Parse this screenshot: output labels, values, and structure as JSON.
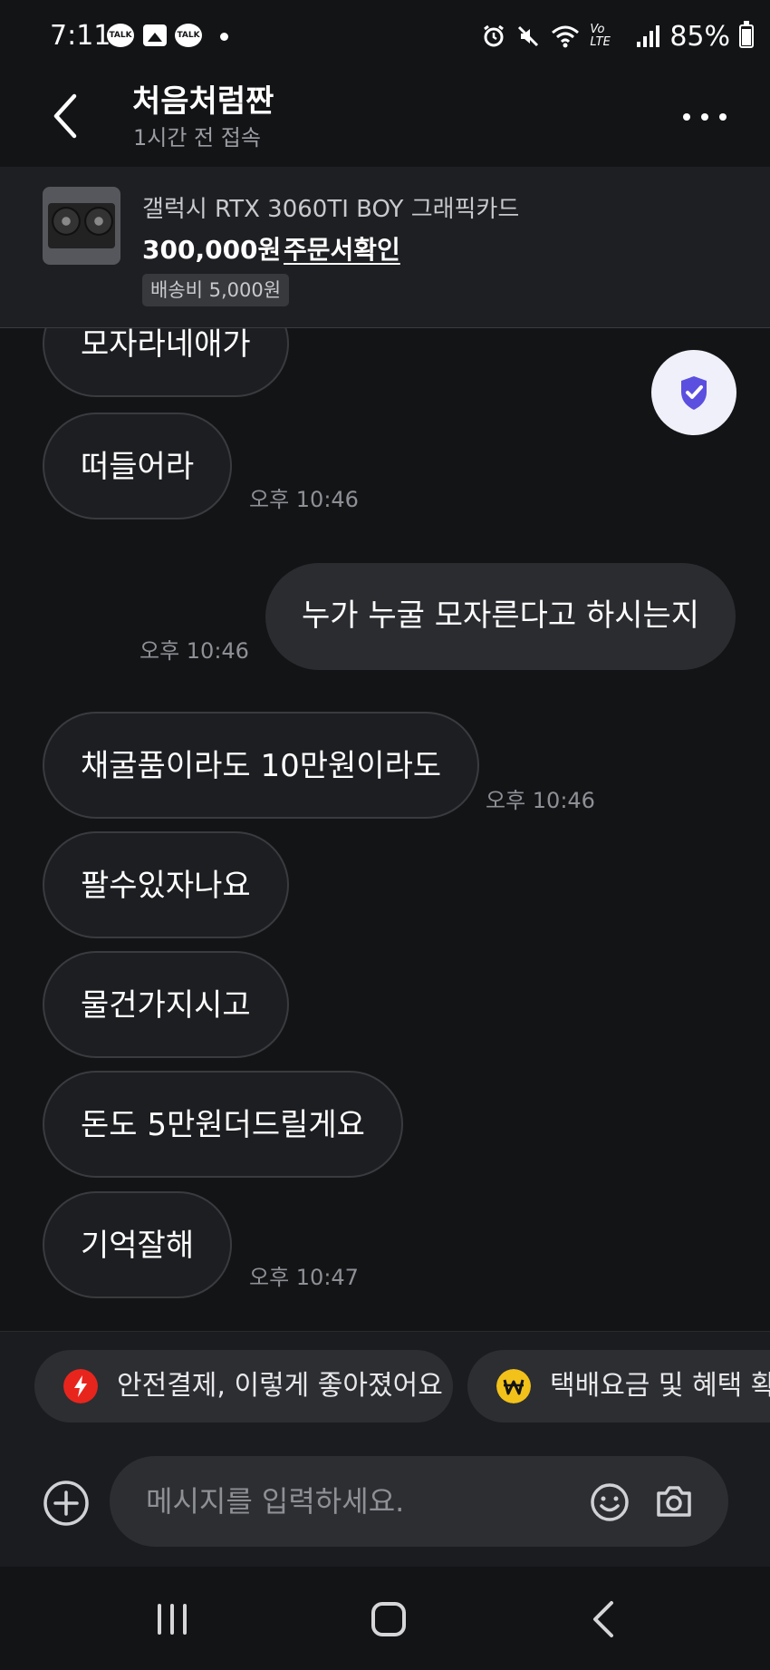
{
  "status_bar": {
    "time": "7:11",
    "notification_icons": [
      "talk-icon",
      "gallery-icon",
      "talk-icon"
    ],
    "talk_label": "TALK",
    "network_label": "Vo LTE",
    "battery": "85%"
  },
  "header": {
    "title": "처음처럼짠",
    "subtitle": "1시간 전 접속"
  },
  "product": {
    "name": "갤럭시 RTX 3060TI BOY 그래픽카드",
    "price": "300,000원",
    "order_link": "주문서확인",
    "shipping": "배송비 5,000원"
  },
  "messages": [
    {
      "side": "in",
      "text": "모자라네애가",
      "time": ""
    },
    {
      "side": "in",
      "text": "떠들어라",
      "time": "오후 10:46"
    },
    {
      "side": "out",
      "text": "누가 누굴 모자른다고 하시는지",
      "time": "오후 10:46"
    },
    {
      "side": "in",
      "text": "채굴품이라도 10만원이라도",
      "time": "오후 10:46"
    },
    {
      "side": "in",
      "text": "팔수있자나요",
      "time": ""
    },
    {
      "side": "in",
      "text": "물건가지시고",
      "time": ""
    },
    {
      "side": "in",
      "text": "돈도 5만원더드릴게요",
      "time": ""
    },
    {
      "side": "in",
      "text": "기억잘해",
      "time": "오후 10:47"
    }
  ],
  "suggestions": [
    {
      "label": "안전결제, 이렇게 좋아졌어요",
      "icon": "lightning-icon",
      "color": "#e8251d"
    },
    {
      "label": "택배요금 및 혜택 확인",
      "icon": "won-icon",
      "color": "#f2c21b"
    }
  ],
  "composer": {
    "placeholder": "메시지를 입력하세요."
  },
  "colors": {
    "background": "#131416",
    "bubble_in": "#1d1e21",
    "bubble_out": "#2b2c30",
    "safety_accent": "#5b4fe0"
  }
}
